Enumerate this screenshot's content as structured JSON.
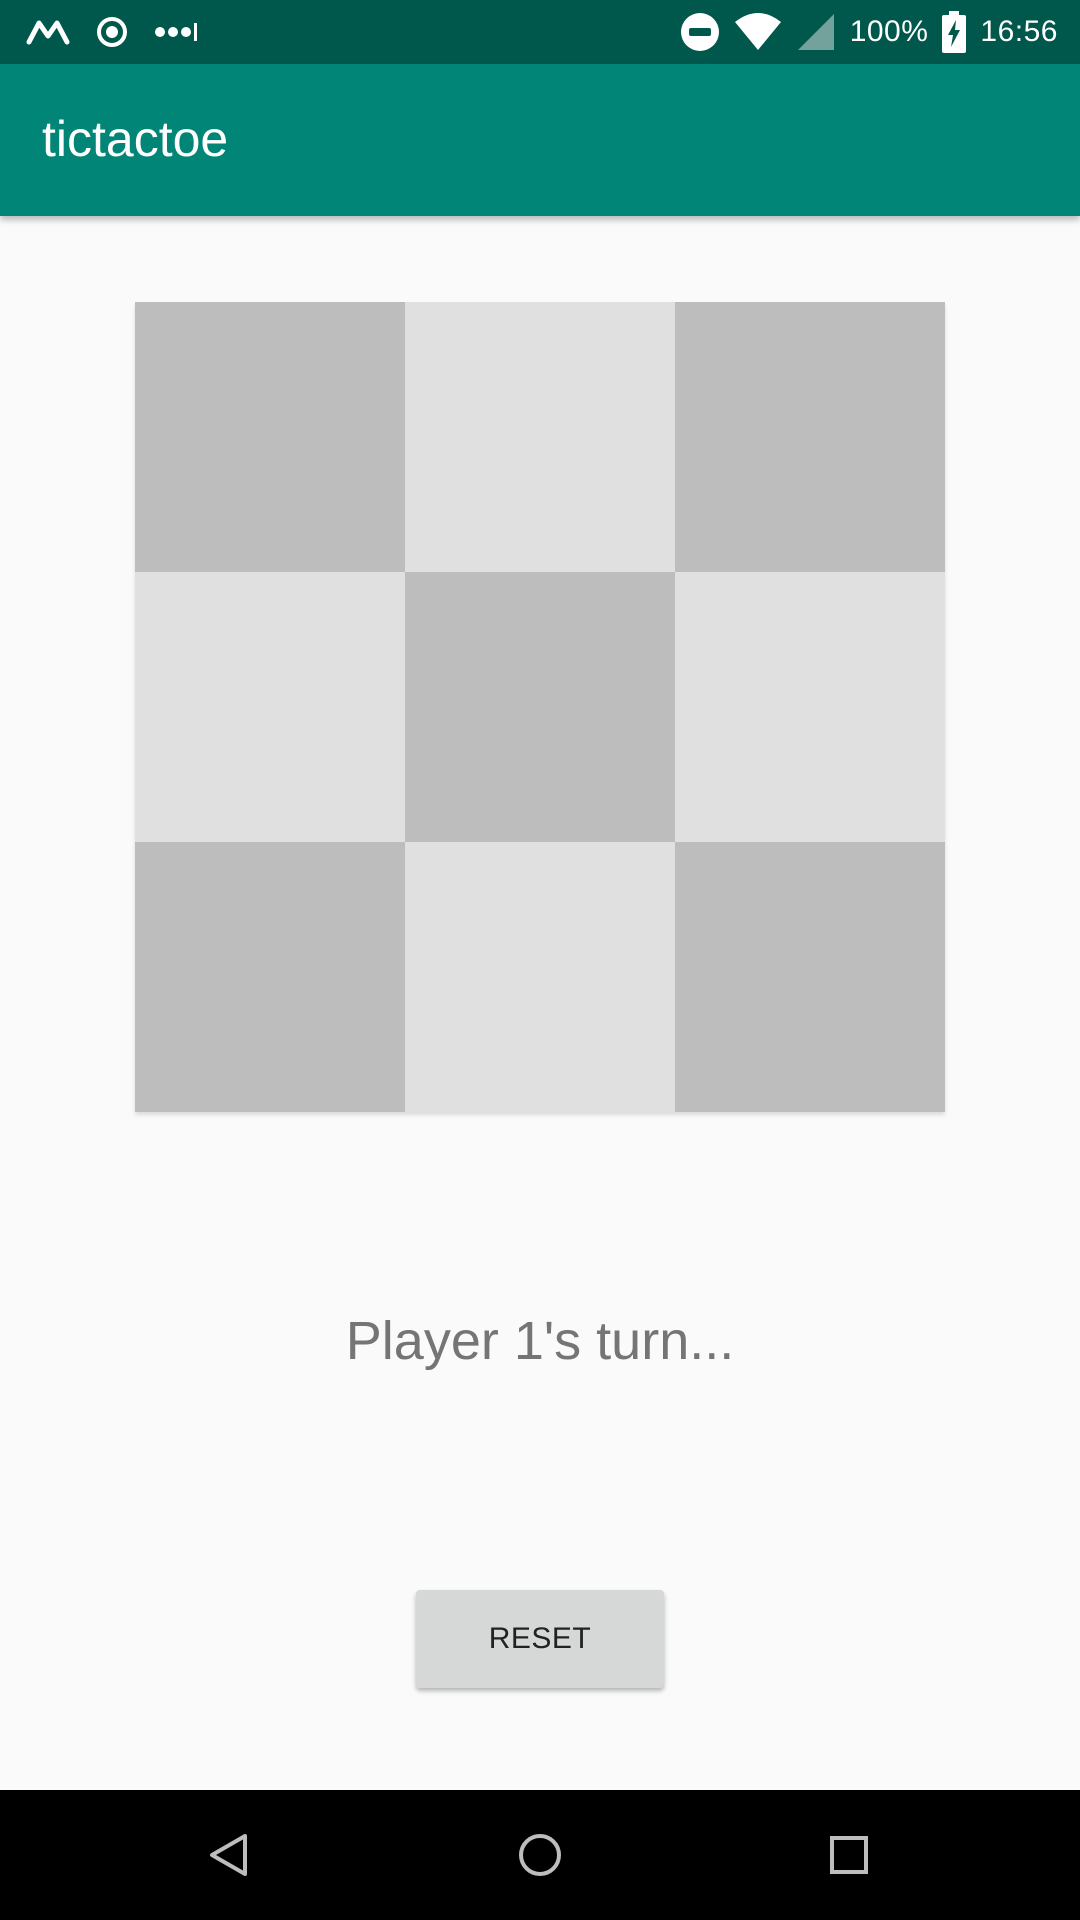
{
  "status_bar": {
    "battery_percent": "100%",
    "time": "16:56",
    "icons": [
      "m-notification-icon",
      "target-notification-icon",
      "more-dots-icon",
      "do-not-disturb-icon",
      "wifi-icon",
      "cell-signal-icon",
      "battery-charging-icon"
    ]
  },
  "app_bar": {
    "title": "tictactoe"
  },
  "board": {
    "cells": [
      "",
      "",
      "",
      "",
      "",
      "",
      "",
      "",
      ""
    ]
  },
  "status": {
    "turn_text": "Player 1's turn..."
  },
  "controls": {
    "reset_label": "RESET"
  },
  "nav_bar": {
    "icons": [
      "back-icon",
      "home-icon",
      "recents-icon"
    ]
  },
  "colors": {
    "status_bar": "#00574b",
    "app_bar": "#008577",
    "cell_dark": "#bdbdbd",
    "cell_light": "#e0e0e0",
    "turn_text": "#757575",
    "button_bg": "#d6d7d7"
  }
}
